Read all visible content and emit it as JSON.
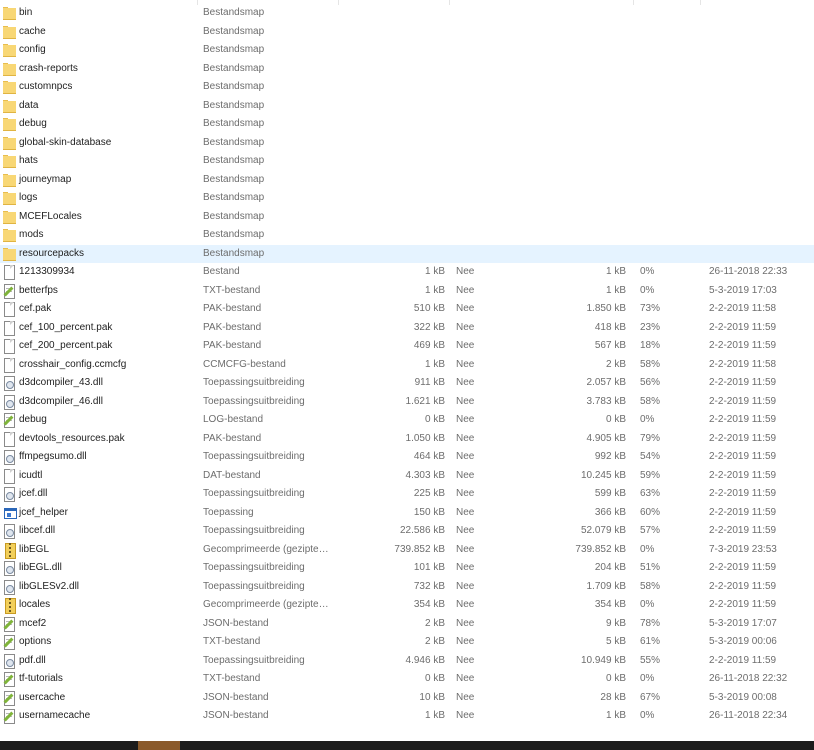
{
  "files": [
    {
      "name": "bin",
      "type": "Bestandsmap",
      "size": "",
      "protected": "",
      "packed": "",
      "ratio": "",
      "modified": "",
      "icon": "folder-icon"
    },
    {
      "name": "cache",
      "type": "Bestandsmap",
      "size": "",
      "protected": "",
      "packed": "",
      "ratio": "",
      "modified": "",
      "icon": "folder-icon"
    },
    {
      "name": "config",
      "type": "Bestandsmap",
      "size": "",
      "protected": "",
      "packed": "",
      "ratio": "",
      "modified": "",
      "icon": "folder-icon"
    },
    {
      "name": "crash-reports",
      "type": "Bestandsmap",
      "size": "",
      "protected": "",
      "packed": "",
      "ratio": "",
      "modified": "",
      "icon": "folder-icon"
    },
    {
      "name": "customnpcs",
      "type": "Bestandsmap",
      "size": "",
      "protected": "",
      "packed": "",
      "ratio": "",
      "modified": "",
      "icon": "folder-icon"
    },
    {
      "name": "data",
      "type": "Bestandsmap",
      "size": "",
      "protected": "",
      "packed": "",
      "ratio": "",
      "modified": "",
      "icon": "folder-icon"
    },
    {
      "name": "debug",
      "type": "Bestandsmap",
      "size": "",
      "protected": "",
      "packed": "",
      "ratio": "",
      "modified": "",
      "icon": "folder-icon"
    },
    {
      "name": "global-skin-database",
      "type": "Bestandsmap",
      "size": "",
      "protected": "",
      "packed": "",
      "ratio": "",
      "modified": "",
      "icon": "folder-icon"
    },
    {
      "name": "hats",
      "type": "Bestandsmap",
      "size": "",
      "protected": "",
      "packed": "",
      "ratio": "",
      "modified": "",
      "icon": "folder-icon"
    },
    {
      "name": "journeymap",
      "type": "Bestandsmap",
      "size": "",
      "protected": "",
      "packed": "",
      "ratio": "",
      "modified": "",
      "icon": "folder-icon"
    },
    {
      "name": "logs",
      "type": "Bestandsmap",
      "size": "",
      "protected": "",
      "packed": "",
      "ratio": "",
      "modified": "",
      "icon": "folder-icon"
    },
    {
      "name": "MCEFLocales",
      "type": "Bestandsmap",
      "size": "",
      "protected": "",
      "packed": "",
      "ratio": "",
      "modified": "",
      "icon": "folder-icon"
    },
    {
      "name": "mods",
      "type": "Bestandsmap",
      "size": "",
      "protected": "",
      "packed": "",
      "ratio": "",
      "modified": "",
      "icon": "folder-icon"
    },
    {
      "name": "resourcepacks",
      "type": "Bestandsmap",
      "size": "",
      "protected": "",
      "packed": "",
      "ratio": "",
      "modified": "",
      "icon": "folder-icon",
      "selected": true
    },
    {
      "name": "1213309934",
      "type": "Bestand",
      "size": "1 kB",
      "protected": "Nee",
      "packed": "1 kB",
      "ratio": "0%",
      "modified": "26-11-2018 22:33",
      "icon": "file-icon"
    },
    {
      "name": "betterfps",
      "type": "TXT-bestand",
      "size": "1 kB",
      "protected": "Nee",
      "packed": "1 kB",
      "ratio": "0%",
      "modified": "5-3-2019 17:03",
      "icon": "text-file-icon"
    },
    {
      "name": "cef.pak",
      "type": "PAK-bestand",
      "size": "510 kB",
      "protected": "Nee",
      "packed": "1.850 kB",
      "ratio": "73%",
      "modified": "2-2-2019 11:58",
      "icon": "file-icon"
    },
    {
      "name": "cef_100_percent.pak",
      "type": "PAK-bestand",
      "size": "322 kB",
      "protected": "Nee",
      "packed": "418 kB",
      "ratio": "23%",
      "modified": "2-2-2019 11:59",
      "icon": "file-icon"
    },
    {
      "name": "cef_200_percent.pak",
      "type": "PAK-bestand",
      "size": "469 kB",
      "protected": "Nee",
      "packed": "567 kB",
      "ratio": "18%",
      "modified": "2-2-2019 11:59",
      "icon": "file-icon"
    },
    {
      "name": "crosshair_config.ccmcfg",
      "type": "CCMCFG-bestand",
      "size": "1 kB",
      "protected": "Nee",
      "packed": "2 kB",
      "ratio": "58%",
      "modified": "2-2-2019 11:58",
      "icon": "file-icon"
    },
    {
      "name": "d3dcompiler_43.dll",
      "type": "Toepassingsuitbreiding",
      "size": "911 kB",
      "protected": "Nee",
      "packed": "2.057 kB",
      "ratio": "56%",
      "modified": "2-2-2019 11:59",
      "icon": "dll-icon"
    },
    {
      "name": "d3dcompiler_46.dll",
      "type": "Toepassingsuitbreiding",
      "size": "1.621 kB",
      "protected": "Nee",
      "packed": "3.783 kB",
      "ratio": "58%",
      "modified": "2-2-2019 11:59",
      "icon": "dll-icon"
    },
    {
      "name": "debug",
      "type": "LOG-bestand",
      "size": "0 kB",
      "protected": "Nee",
      "packed": "0 kB",
      "ratio": "0%",
      "modified": "2-2-2019 11:59",
      "icon": "text-file-icon"
    },
    {
      "name": "devtools_resources.pak",
      "type": "PAK-bestand",
      "size": "1.050 kB",
      "protected": "Nee",
      "packed": "4.905 kB",
      "ratio": "79%",
      "modified": "2-2-2019 11:59",
      "icon": "file-icon"
    },
    {
      "name": "ffmpegsumo.dll",
      "type": "Toepassingsuitbreiding",
      "size": "464 kB",
      "protected": "Nee",
      "packed": "992 kB",
      "ratio": "54%",
      "modified": "2-2-2019 11:59",
      "icon": "dll-icon"
    },
    {
      "name": "icudtl",
      "type": "DAT-bestand",
      "size": "4.303 kB",
      "protected": "Nee",
      "packed": "10.245 kB",
      "ratio": "59%",
      "modified": "2-2-2019 11:59",
      "icon": "file-icon"
    },
    {
      "name": "jcef.dll",
      "type": "Toepassingsuitbreiding",
      "size": "225 kB",
      "protected": "Nee",
      "packed": "599 kB",
      "ratio": "63%",
      "modified": "2-2-2019 11:59",
      "icon": "dll-icon"
    },
    {
      "name": "jcef_helper",
      "type": "Toepassing",
      "size": "150 kB",
      "protected": "Nee",
      "packed": "366 kB",
      "ratio": "60%",
      "modified": "2-2-2019 11:59",
      "icon": "application-icon"
    },
    {
      "name": "libcef.dll",
      "type": "Toepassingsuitbreiding",
      "size": "22.586 kB",
      "protected": "Nee",
      "packed": "52.079 kB",
      "ratio": "57%",
      "modified": "2-2-2019 11:59",
      "icon": "dll-icon"
    },
    {
      "name": "libEGL",
      "type": "Gecomprimeerde (gezipte…",
      "size": "739.852 kB",
      "protected": "Nee",
      "packed": "739.852 kB",
      "ratio": "0%",
      "modified": "7-3-2019 23:53",
      "icon": "zip-icon"
    },
    {
      "name": "libEGL.dll",
      "type": "Toepassingsuitbreiding",
      "size": "101 kB",
      "protected": "Nee",
      "packed": "204 kB",
      "ratio": "51%",
      "modified": "2-2-2019 11:59",
      "icon": "dll-icon"
    },
    {
      "name": "libGLESv2.dll",
      "type": "Toepassingsuitbreiding",
      "size": "732 kB",
      "protected": "Nee",
      "packed": "1.709 kB",
      "ratio": "58%",
      "modified": "2-2-2019 11:59",
      "icon": "dll-icon"
    },
    {
      "name": "locales",
      "type": "Gecomprimeerde (gezipte…",
      "size": "354 kB",
      "protected": "Nee",
      "packed": "354 kB",
      "ratio": "0%",
      "modified": "2-2-2019 11:59",
      "icon": "zip-icon"
    },
    {
      "name": "mcef2",
      "type": "JSON-bestand",
      "size": "2 kB",
      "protected": "Nee",
      "packed": "9 kB",
      "ratio": "78%",
      "modified": "5-3-2019 17:07",
      "icon": "text-file-icon"
    },
    {
      "name": "options",
      "type": "TXT-bestand",
      "size": "2 kB",
      "protected": "Nee",
      "packed": "5 kB",
      "ratio": "61%",
      "modified": "5-3-2019 00:06",
      "icon": "text-file-icon"
    },
    {
      "name": "pdf.dll",
      "type": "Toepassingsuitbreiding",
      "size": "4.946 kB",
      "protected": "Nee",
      "packed": "10.949 kB",
      "ratio": "55%",
      "modified": "2-2-2019 11:59",
      "icon": "dll-icon"
    },
    {
      "name": "tf-tutorials",
      "type": "TXT-bestand",
      "size": "0 kB",
      "protected": "Nee",
      "packed": "0 kB",
      "ratio": "0%",
      "modified": "26-11-2018 22:32",
      "icon": "text-file-icon"
    },
    {
      "name": "usercache",
      "type": "JSON-bestand",
      "size": "10 kB",
      "protected": "Nee",
      "packed": "28 kB",
      "ratio": "67%",
      "modified": "5-3-2019 00:08",
      "icon": "text-file-icon"
    },
    {
      "name": "usernamecache",
      "type": "JSON-bestand",
      "size": "1 kB",
      "protected": "Nee",
      "packed": "1 kB",
      "ratio": "0%",
      "modified": "26-11-2018 22:34",
      "icon": "text-file-icon"
    }
  ],
  "colors": {
    "selected_row": "#e5f3ff",
    "taskbar": "#1c1c1c",
    "taskbar_active": "#8a5a2b",
    "folder": "#f8d775"
  }
}
